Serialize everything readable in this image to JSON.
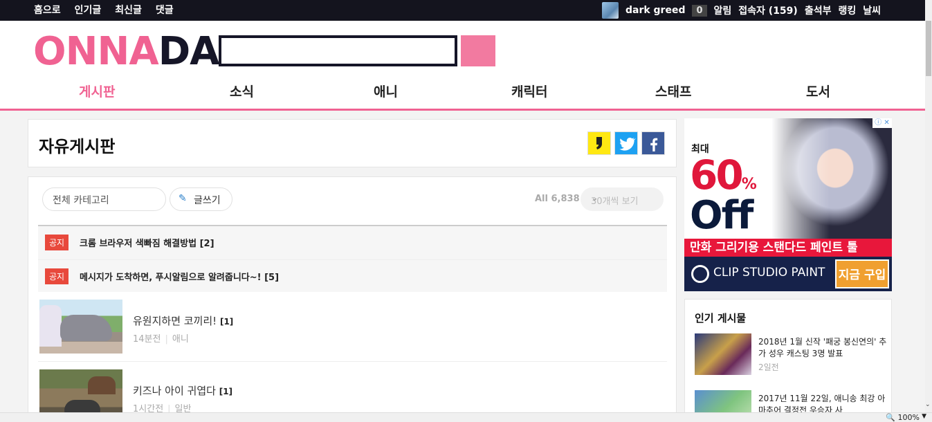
{
  "topbar": {
    "nav": [
      "홈으로",
      "인기글",
      "최신글",
      "댓글"
    ],
    "user": "dark greed",
    "notification_count": "0",
    "links": [
      "알림",
      "접속자 (159)",
      "출석부",
      "랭킹",
      "날씨"
    ]
  },
  "header": {
    "logo_part1": "ONNA",
    "logo_part2": "DA",
    "search_value": ""
  },
  "main_nav": [
    "게시판",
    "소식",
    "애니",
    "캐릭터",
    "스태프",
    "도서"
  ],
  "board": {
    "title": "자유게시판",
    "category_select": "전체 카테고리",
    "write_label": "글쓰기",
    "count_label": "All 6,838",
    "per_page": "30개씩 보기"
  },
  "notices": [
    {
      "badge": "공지",
      "title": "크롬 브라우저 색빠짐 해결방법",
      "comments": "[2]"
    },
    {
      "badge": "공지",
      "title": "메시지가 도착하면, 푸시알림으로 알려줍니다~!",
      "comments": "[5]"
    }
  ],
  "posts": [
    {
      "title": "유원지하면 코끼리!",
      "comments": "[1]",
      "time": "14분전",
      "category": "애니"
    },
    {
      "title": "키즈나 아이 귀엽다",
      "comments": "[1]",
      "time": "1시간전",
      "category": "일반"
    }
  ],
  "ad": {
    "label_top": "최대",
    "big_number": "60",
    "percent": "%",
    "off": "Off",
    "tagline": "만화 그리기용 스탠다드 페인트 툴",
    "brand": "CLIP STUDIO PAINT",
    "buy": "지금 구입"
  },
  "popular": {
    "heading": "인기 게시물",
    "items": [
      {
        "title": "2018년 1월 신작 '패궁 봉신연의' 추가 성우 캐스팅 3명 발표",
        "time": "2일전"
      },
      {
        "title": "2017년 11월 22일, 애니송 최강 아마추어 결정전 우승자 사",
        "time": ""
      }
    ]
  },
  "statusbar": {
    "zoom": "100%"
  }
}
